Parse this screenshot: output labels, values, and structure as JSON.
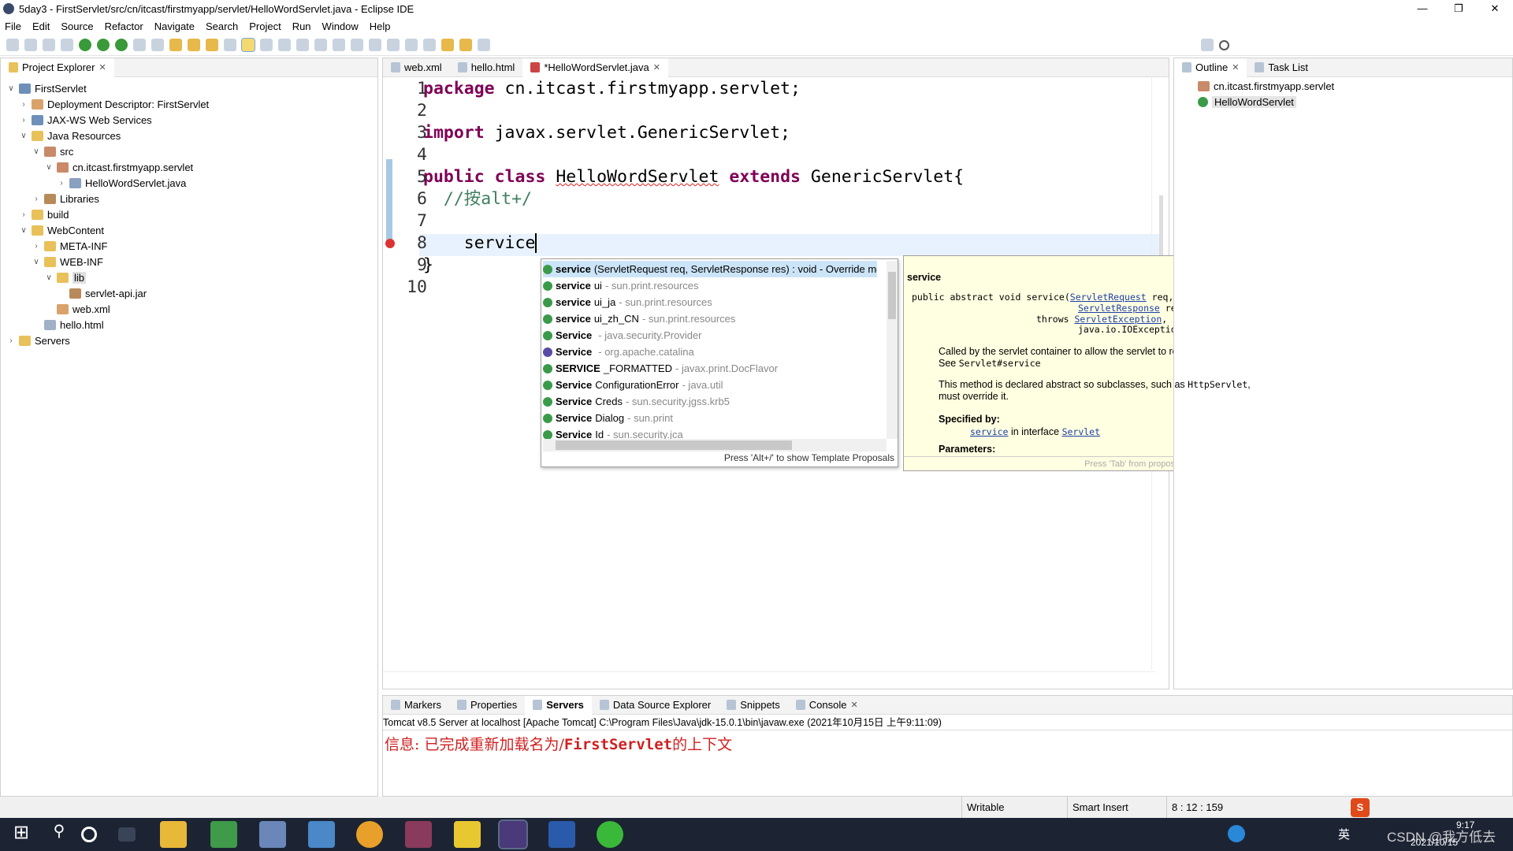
{
  "window": {
    "title": "5day3 - FirstServlet/src/cn/itcast/firstmyapp/servlet/HelloWordServlet.java - Eclipse IDE"
  },
  "menu": [
    "File",
    "Edit",
    "Source",
    "Refactor",
    "Navigate",
    "Search",
    "Project",
    "Run",
    "Window",
    "Help"
  ],
  "project_explorer": {
    "title": "Project Explorer",
    "tree": [
      {
        "label": "FirstServlet",
        "depth": 0,
        "twisty": "v",
        "icon": "proj"
      },
      {
        "label": "Deployment Descriptor: FirstServlet",
        "depth": 1,
        "twisty": ">",
        "icon": "xml"
      },
      {
        "label": "JAX-WS Web Services",
        "depth": 1,
        "twisty": ">",
        "icon": "proj"
      },
      {
        "label": "Java Resources",
        "depth": 1,
        "twisty": "v",
        "icon": "folder"
      },
      {
        "label": "src",
        "depth": 2,
        "twisty": "v",
        "icon": "pkg"
      },
      {
        "label": "cn.itcast.firstmyapp.servlet",
        "depth": 3,
        "twisty": "v",
        "icon": "pkg"
      },
      {
        "label": "HelloWordServlet.java",
        "depth": 4,
        "twisty": ">",
        "icon": "jfile"
      },
      {
        "label": "Libraries",
        "depth": 2,
        "twisty": ">",
        "icon": "jar"
      },
      {
        "label": "build",
        "depth": 1,
        "twisty": ">",
        "icon": "folder"
      },
      {
        "label": "WebContent",
        "depth": 1,
        "twisty": "v",
        "icon": "folder"
      },
      {
        "label": "META-INF",
        "depth": 2,
        "twisty": ">",
        "icon": "folder"
      },
      {
        "label": "WEB-INF",
        "depth": 2,
        "twisty": "v",
        "icon": "folder"
      },
      {
        "label": "lib",
        "depth": 3,
        "twisty": "v",
        "icon": "folder",
        "selected": true
      },
      {
        "label": "servlet-api.jar",
        "depth": 4,
        "twisty": "",
        "icon": "jar"
      },
      {
        "label": "web.xml",
        "depth": 3,
        "twisty": "",
        "icon": "xml"
      },
      {
        "label": "hello.html",
        "depth": 2,
        "twisty": "",
        "icon": "html"
      },
      {
        "label": "Servers",
        "depth": 0,
        "twisty": ">",
        "icon": "folder"
      }
    ]
  },
  "editor": {
    "tabs": [
      {
        "label": "web.xml"
      },
      {
        "label": "hello.html"
      },
      {
        "label": "*HelloWordServlet.java",
        "active": true
      }
    ],
    "lines": [
      "1",
      "2",
      "3",
      "4",
      "5",
      "6",
      "7",
      "8",
      "9",
      "10"
    ],
    "code": {
      "l1_kw": "package",
      "l1_rest": " cn.itcast.firstmyapp.servlet;",
      "l3_kw": "import",
      "l3_rest": " javax.servlet.GenericServlet;",
      "l5_kw1": "public",
      "l5_kw2": "class",
      "l5_name": "HelloWordServlet",
      "l5_kw3": "extends",
      "l5_rest": " GenericServlet{",
      "l6_comment": "  //按alt+/",
      "l8_text": "    service",
      "l9_text": "}"
    }
  },
  "completion": {
    "proposals": [
      {
        "bold": "service",
        "rest": "(ServletRequest req, ServletResponse res) : void - Override method in 'GenericServlet'",
        "qual": "",
        "icon": "override-method",
        "selected": true
      },
      {
        "bold": "service",
        "rest": "ui",
        "qual": " - sun.print.resources",
        "icon": "class"
      },
      {
        "bold": "service",
        "rest": "ui_ja",
        "qual": " - sun.print.resources",
        "icon": "class"
      },
      {
        "bold": "service",
        "rest": "ui_zh_CN",
        "qual": " - sun.print.resources",
        "icon": "class"
      },
      {
        "bold": "Service",
        "rest": "",
        "qual": " - java.security.Provider",
        "icon": "class"
      },
      {
        "bold": "Service",
        "rest": "",
        "qual": " - org.apache.catalina",
        "icon": "interface"
      },
      {
        "bold": "SERVICE",
        "rest": "_FORMATTED",
        "qual": " - javax.print.DocFlavor",
        "icon": "class"
      },
      {
        "bold": "Service",
        "rest": "ConfigurationError",
        "qual": " - java.util",
        "icon": "class"
      },
      {
        "bold": "Service",
        "rest": "Creds",
        "qual": " - sun.security.jgss.krb5",
        "icon": "class"
      },
      {
        "bold": "Service",
        "rest": "Dialog",
        "qual": " - sun.print",
        "icon": "class"
      },
      {
        "bold": "Service",
        "rest": "Id",
        "qual": " - sun.security.jca",
        "icon": "class"
      }
    ],
    "footer": "Press 'Alt+/' to show Template Proposals"
  },
  "doc": {
    "title": "service",
    "sig1": "public abstract void service(",
    "sig_req": "ServletRequest",
    "sig_req2": " req,",
    "sig_res": "ServletResponse",
    "sig_res2": " res)",
    "throws": "throws ",
    "sig_exc": "ServletException",
    "sig_exc2": ",",
    "sig_io": "java.io.IOException",
    "p1a": "Called by the servlet container to allow the servlet to respond to a request. See ",
    "p1code": "Servlet#service",
    ".": ".",
    "p2a": "This method is declared abstract so subclasses, such as ",
    "p2code": "HttpServlet",
    "p2b": ", must override it.",
    "specified_by": "Specified by:",
    "spec_link": "service",
    "spec_mid": " in interface ",
    "spec_iface": "Servlet",
    "parameters": "Parameters:",
    "footer": "Press 'Tab' from proposal table or click for focus"
  },
  "outline": {
    "tabs": [
      {
        "label": "Outline"
      },
      {
        "label": "Task List"
      }
    ],
    "items": [
      "cn.itcast.firstmyapp.servlet",
      "HelloWordServlet"
    ]
  },
  "bottom": {
    "tabs": [
      {
        "label": "Markers"
      },
      {
        "label": "Properties"
      },
      {
        "label": "Servers",
        "active": true
      },
      {
        "label": "Data Source Explorer"
      },
      {
        "label": "Snippets"
      },
      {
        "label": "Console"
      }
    ],
    "console_header": "Tomcat v8.5 Server at localhost [Apache Tomcat] C:\\Program Files\\Java\\jdk-15.0.1\\bin\\javaw.exe  (2021年10月15日 上午9:11:09)",
    "console_a": "信息: 已完成重新加载名为/",
    "console_b": "FirstServlet",
    "console_c": "的上下文"
  },
  "status": {
    "writable": "Writable",
    "insert": "Smart Insert",
    "position": "8 : 12 : 159"
  },
  "taskbar": {
    "clock_time": "9:17",
    "clock_date": "2021/10/15",
    "ime": "英",
    "watermark": "CSDN @我方低去"
  }
}
